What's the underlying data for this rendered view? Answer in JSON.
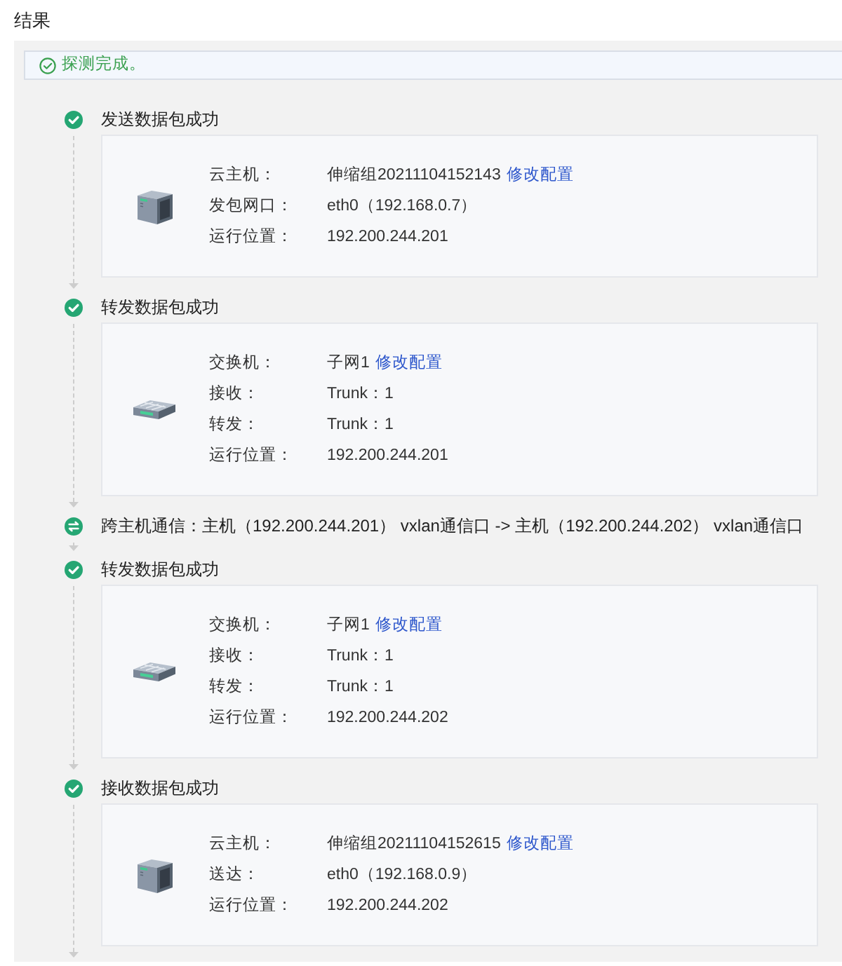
{
  "title": "结果",
  "alert": {
    "text": "探测完成。"
  },
  "steps": [
    {
      "kind": "step",
      "title": "发送数据包成功",
      "card": {
        "kind": "server",
        "fields": [
          {
            "label": "云主机：",
            "value": "伸缩组20211104152143",
            "link": "修改配置"
          },
          {
            "label": "发包网口：",
            "value": "eth0（192.168.0.7）"
          },
          {
            "label": "运行位置：",
            "value": "192.200.244.201"
          }
        ]
      }
    },
    {
      "kind": "step",
      "title": "转发数据包成功",
      "card": {
        "kind": "switch",
        "fields": [
          {
            "label": "交换机：",
            "value": "子网1",
            "link": "修改配置"
          },
          {
            "label": "接收：",
            "value": "Trunk：1"
          },
          {
            "label": "转发：",
            "value": "Trunk：1"
          },
          {
            "label": "运行位置：",
            "value": "192.200.244.201"
          }
        ]
      }
    },
    {
      "kind": "transit",
      "title": "跨主机通信：主机（192.200.244.201） vxlan通信口 -> 主机（192.200.244.202） vxlan通信口"
    },
    {
      "kind": "step",
      "title": "转发数据包成功",
      "card": {
        "kind": "switch",
        "fields": [
          {
            "label": "交换机：",
            "value": "子网1",
            "link": "修改配置"
          },
          {
            "label": "接收：",
            "value": "Trunk：1"
          },
          {
            "label": "转发：",
            "value": "Trunk：1"
          },
          {
            "label": "运行位置：",
            "value": "192.200.244.202"
          }
        ]
      }
    },
    {
      "kind": "step",
      "title": "接收数据包成功",
      "card": {
        "kind": "server",
        "fields": [
          {
            "label": "云主机：",
            "value": "伸缩组20211104152615",
            "link": "修改配置"
          },
          {
            "label": "送达：",
            "value": "eth0（192.168.0.9）"
          },
          {
            "label": "运行位置：",
            "value": "192.200.244.202"
          }
        ]
      }
    }
  ]
}
